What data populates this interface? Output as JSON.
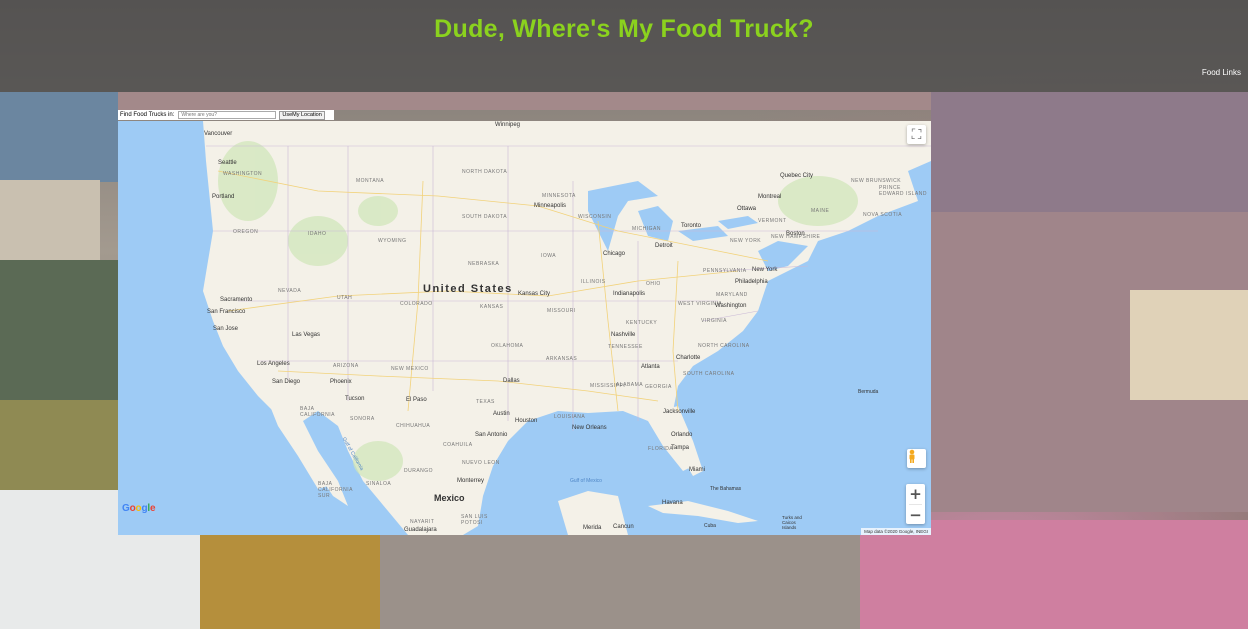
{
  "header": {
    "title": "Dude, Where's My Food Truck?",
    "food_links": "Food Links",
    "title_color": "#8bd21e"
  },
  "finder": {
    "label": "Find Food Trucks in:",
    "placeholder": "Where are you?",
    "use_location": "UseMy Location"
  },
  "map": {
    "country_label": "United States",
    "mexico_label": "Mexico",
    "google": "Google",
    "attribution": "Map data ©2020 Google, INEGI",
    "cities": [
      "Vancouver",
      "Seattle",
      "Portland",
      "Sacramento",
      "San Francisco",
      "San Jose",
      "Los Angeles",
      "San Diego",
      "Las Vegas",
      "Phoenix",
      "Tucson",
      "El Paso",
      "Dallas",
      "Austin",
      "Houston",
      "San Antonio",
      "New Orleans",
      "Monterrey",
      "Kansas City",
      "Minneapolis",
      "Chicago",
      "Detroit",
      "Toronto",
      "Indianapolis",
      "Nashville",
      "Atlanta",
      "Charlotte",
      "Washington",
      "Philadelphia",
      "New York",
      "Boston",
      "Montreal",
      "Ottawa",
      "Quebec City",
      "Jacksonville",
      "Orlando",
      "Tampa",
      "Miami",
      "Havana",
      "Winnipeg",
      "Merida",
      "Cancun",
      "Guadalajara",
      "Bermuda",
      "The Bahamas",
      "Cuba",
      "Turks and Caicos Islands"
    ],
    "states": [
      "WASHINGTON",
      "OREGON",
      "IDAHO",
      "MONTANA",
      "WYOMING",
      "NEVADA",
      "UTAH",
      "COLORADO",
      "ARIZONA",
      "NEW MEXICO",
      "NORTH DAKOTA",
      "SOUTH DAKOTA",
      "NEBRASKA",
      "KANSAS",
      "OKLAHOMA",
      "TEXAS",
      "MINNESOTA",
      "IOWA",
      "MISSOURI",
      "ARKANSAS",
      "LOUISIANA",
      "WISCONSIN",
      "ILLINOIS",
      "MICHIGAN",
      "OHIO",
      "KENTUCKY",
      "TENNESSEE",
      "MISSISSIPPI",
      "ALABAMA",
      "GEORGIA",
      "FLORIDA",
      "SOUTH CAROLINA",
      "NORTH CAROLINA",
      "VIRGINIA",
      "WEST VIRGINIA",
      "PENNSYLVANIA",
      "NEW YORK",
      "MAINE",
      "NEW HAMPSHIRE",
      "VERMONT",
      "MARYLAND",
      "NEW BRUNSWICK",
      "NOVA SCOTIA",
      "PRINCE EDWARD ISLAND",
      "BAJA CALIFORNIA",
      "SONORA",
      "CHIHUAHUA",
      "COAHUILA",
      "NUEVO LEON",
      "DURANGO",
      "SINALOA",
      "NAYARIT",
      "SAN LUIS POTOSI",
      "BAJA CALIFORNIA SUR"
    ],
    "water": [
      "Gulf of Mexico",
      "Gulf of California"
    ]
  }
}
